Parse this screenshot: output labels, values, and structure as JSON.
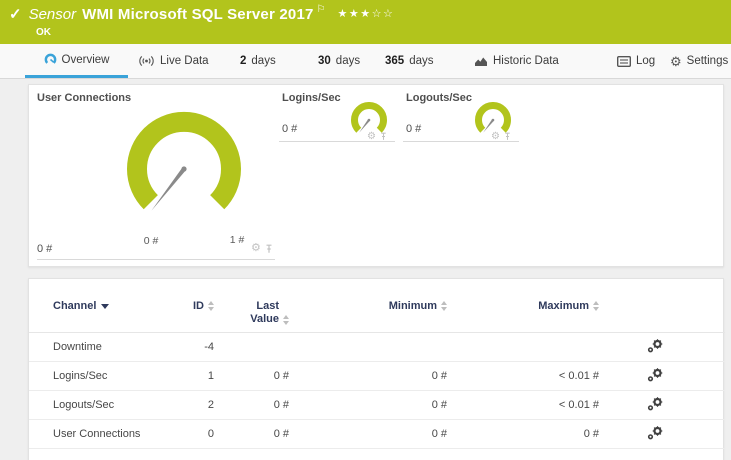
{
  "colors": {
    "green": "#b2c41c",
    "blue": "#3aa3d9"
  },
  "header": {
    "check_icon": "✓",
    "kind": "Sensor",
    "title": "WMI Microsoft SQL Server 2017",
    "flag_icon": "⚐",
    "stars": "★★★☆☆",
    "status": "OK"
  },
  "tabs": {
    "overview": {
      "label": "Overview"
    },
    "live_data": {
      "label": "Live Data"
    },
    "days2": {
      "number": "2",
      "unit": "days"
    },
    "days30": {
      "number": "30",
      "unit": "days"
    },
    "days365": {
      "number": "365",
      "unit": "days"
    },
    "historic": {
      "label": "Historic Data"
    },
    "log": {
      "label": "Log"
    },
    "settings": {
      "label": "Settings"
    }
  },
  "gauges": {
    "user_connections": {
      "title": "User Connections",
      "value": "0 #",
      "scale_min": "0 #",
      "scale_max": "1 #"
    },
    "logins": {
      "title": "Logins/Sec",
      "value": "0 #"
    },
    "logouts": {
      "title": "Logouts/Sec",
      "value": "0 #"
    }
  },
  "table": {
    "headers": {
      "channel": "Channel",
      "id": "ID",
      "last_value": "Last Value",
      "minimum": "Minimum",
      "maximum": "Maximum"
    },
    "rows": [
      {
        "channel": "Downtime",
        "id": "-4",
        "last_value": "",
        "minimum": "",
        "maximum": ""
      },
      {
        "channel": "Logins/Sec",
        "id": "1",
        "last_value": "0 #",
        "minimum": "0 #",
        "maximum": "< 0.01 #"
      },
      {
        "channel": "Logouts/Sec",
        "id": "2",
        "last_value": "0 #",
        "minimum": "0 #",
        "maximum": "< 0.01 #"
      },
      {
        "channel": "User Connections",
        "id": "0",
        "last_value": "0 #",
        "minimum": "0 #",
        "maximum": "0 #"
      }
    ]
  }
}
